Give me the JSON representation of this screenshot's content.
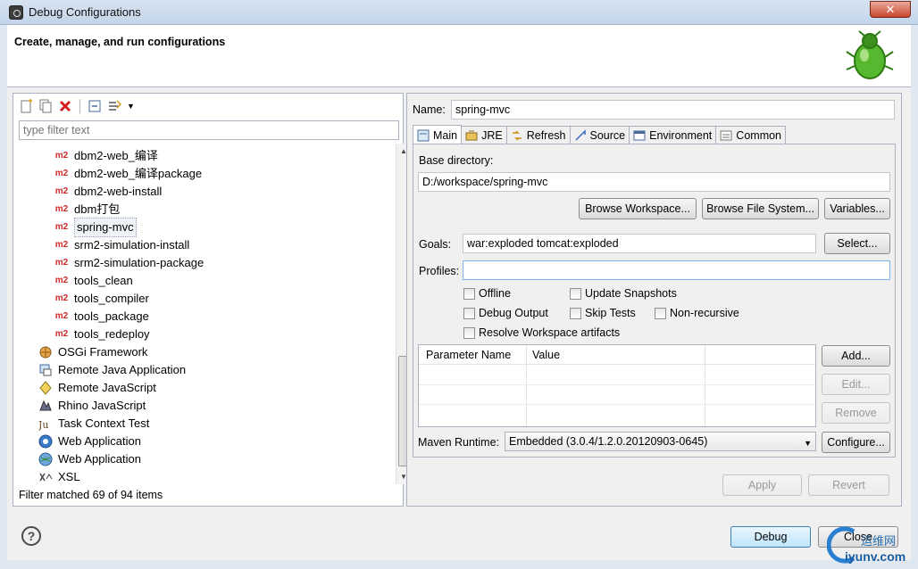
{
  "window": {
    "title": "Debug Configurations",
    "close_glyph": "✕"
  },
  "header": {
    "heading": "Create, manage, and run configurations",
    "icon": "bug-icon"
  },
  "left": {
    "filter_placeholder": "type filter text",
    "tree_items": [
      {
        "label": "dbm2-web_编译",
        "kind": "m2"
      },
      {
        "label": "dbm2-web_编译package",
        "kind": "m2"
      },
      {
        "label": "dbm2-web-install",
        "kind": "m2"
      },
      {
        "label": "dbm打包",
        "kind": "m2"
      },
      {
        "label": "spring-mvc",
        "kind": "m2",
        "selected": true
      },
      {
        "label": "srm2-simulation-install",
        "kind": "m2"
      },
      {
        "label": "srm2-simulation-package",
        "kind": "m2"
      },
      {
        "label": "tools_clean",
        "kind": "m2"
      },
      {
        "label": "tools_compiler",
        "kind": "m2"
      },
      {
        "label": "tools_package",
        "kind": "m2"
      },
      {
        "label": "tools_redeploy",
        "kind": "m2"
      },
      {
        "label": "OSGi Framework",
        "kind": "osgi-icon"
      },
      {
        "label": "Remote Java Application",
        "kind": "remote-java-icon"
      },
      {
        "label": "Remote JavaScript",
        "kind": "remote-js-icon"
      },
      {
        "label": "Rhino JavaScript",
        "kind": "rhino-icon"
      },
      {
        "label": "Task Context Test",
        "kind": "junit-icon"
      },
      {
        "label": "Web Application",
        "kind": "web-app-icon"
      },
      {
        "label": "Web Application",
        "kind": "web-app-globe-icon"
      },
      {
        "label": "XSL",
        "kind": "xsl-icon"
      }
    ],
    "m2_badge": "m2",
    "status": "Filter matched 69 of 94 items"
  },
  "right": {
    "name_label": "Name:",
    "name_value": "spring-mvc",
    "tabs": [
      {
        "label": "Main",
        "icon": "main-tab-icon",
        "active": true
      },
      {
        "label": "JRE",
        "icon": "jre-icon"
      },
      {
        "label": "Refresh",
        "icon": "refresh-icon"
      },
      {
        "label": "Source",
        "icon": "source-icon"
      },
      {
        "label": "Environment",
        "icon": "environment-icon"
      },
      {
        "label": "Common",
        "icon": "common-icon"
      }
    ],
    "base_dir_label": "Base directory:",
    "base_dir_value": "D:/workspace/spring-mvc",
    "browse_workspace": "Browse Workspace...",
    "browse_fs": "Browse File System...",
    "variables": "Variables...",
    "goals_label": "Goals:",
    "goals_value": "war:exploded tomcat:exploded",
    "select_btn": "Select...",
    "profiles_label": "Profiles:",
    "profiles_value": "",
    "checkboxes": {
      "offline": "Offline",
      "update_snapshots": "Update Snapshots",
      "debug_output": "Debug Output",
      "skip_tests": "Skip Tests",
      "non_recursive": "Non-recursive",
      "resolve_workspace": "Resolve Workspace artifacts"
    },
    "param_cols": [
      "Parameter Name",
      "Value"
    ],
    "add_btn": "Add...",
    "edit_btn": "Edit...",
    "remove_btn": "Remove",
    "runtime_label": "Maven Runtime:",
    "runtime_value": "Embedded (3.0.4/1.2.0.20120903-0645)",
    "configure_btn": "Configure...",
    "apply_btn": "Apply",
    "revert_btn": "Revert"
  },
  "footer": {
    "help_glyph": "?",
    "debug_btn": "Debug",
    "close_btn": "Close"
  },
  "watermark": {
    "line1": "运维网",
    "line2": "iyunv.com"
  }
}
